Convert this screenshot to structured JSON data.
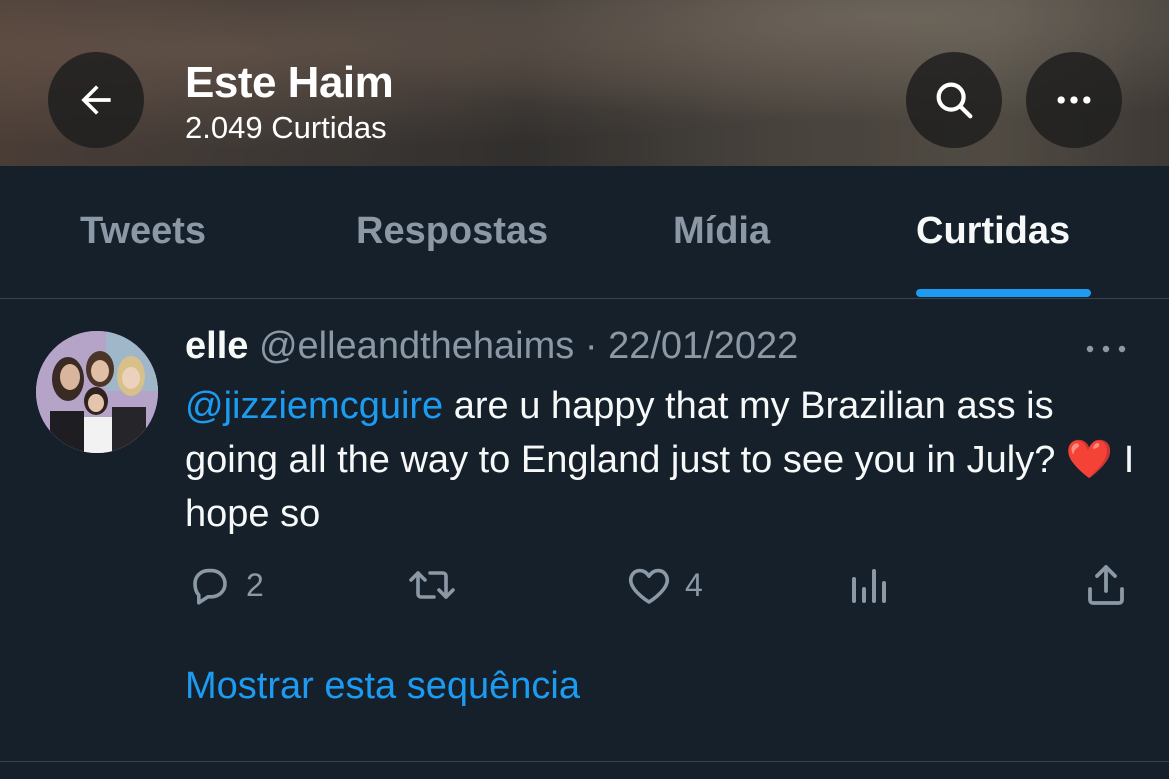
{
  "header": {
    "title": "Este Haim",
    "subtitle": "2.049 Curtidas"
  },
  "tabs": [
    {
      "label": "Tweets",
      "active": false
    },
    {
      "label": "Respostas",
      "active": false
    },
    {
      "label": "Mídia",
      "active": false
    },
    {
      "label": "Curtidas",
      "active": true
    }
  ],
  "tweet": {
    "name": "elle",
    "handle": "@elleandthehaims",
    "separator": "·",
    "date": "22/01/2022",
    "mention": "@jizziemcguire",
    "text": " are u happy that my Brazilian ass is going all the way to England just to see you in July? ",
    "emoji": "❤️",
    "text_end": " I hope so",
    "reply_count": "2",
    "like_count": "4",
    "show_thread": "Mostrar esta sequência"
  },
  "colors": {
    "background": "#15202b",
    "accent": "#1d9bf0",
    "muted": "#8b98a5"
  },
  "icons": [
    "back-arrow-icon",
    "search-icon",
    "more-icon",
    "reply-icon",
    "retweet-icon",
    "like-icon",
    "views-icon",
    "share-icon"
  ]
}
